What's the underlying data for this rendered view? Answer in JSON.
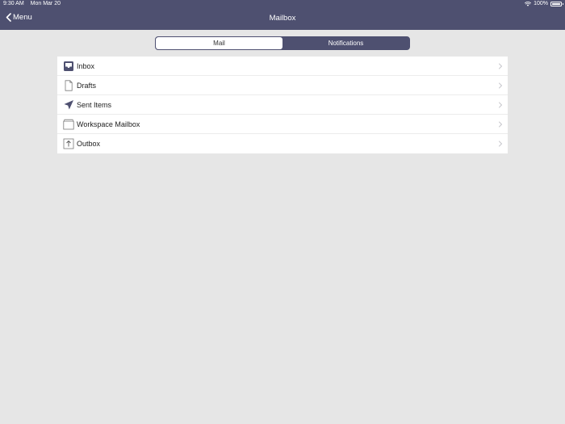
{
  "status_bar": {
    "time": "9:30 AM",
    "date": "Mon Mar 20",
    "battery": "100%",
    "wifi_icon": "wifi-icon",
    "battery_icon": "battery-icon"
  },
  "nav": {
    "back_label": "Menu",
    "title": "Mailbox"
  },
  "tabs": [
    {
      "label": "Mail",
      "selected": true
    },
    {
      "label": "Notifications",
      "selected": false
    }
  ],
  "mailbox_items": [
    {
      "label": "Inbox",
      "icon": "inbox-icon"
    },
    {
      "label": "Drafts",
      "icon": "drafts-icon"
    },
    {
      "label": "Sent Items",
      "icon": "sent-icon"
    },
    {
      "label": "Workspace Mailbox",
      "icon": "workspace-mailbox-icon"
    },
    {
      "label": "Outbox",
      "icon": "outbox-icon"
    }
  ],
  "colors": {
    "header": "#4e5070",
    "background": "#e6e6e6",
    "list_background": "#ffffff"
  }
}
